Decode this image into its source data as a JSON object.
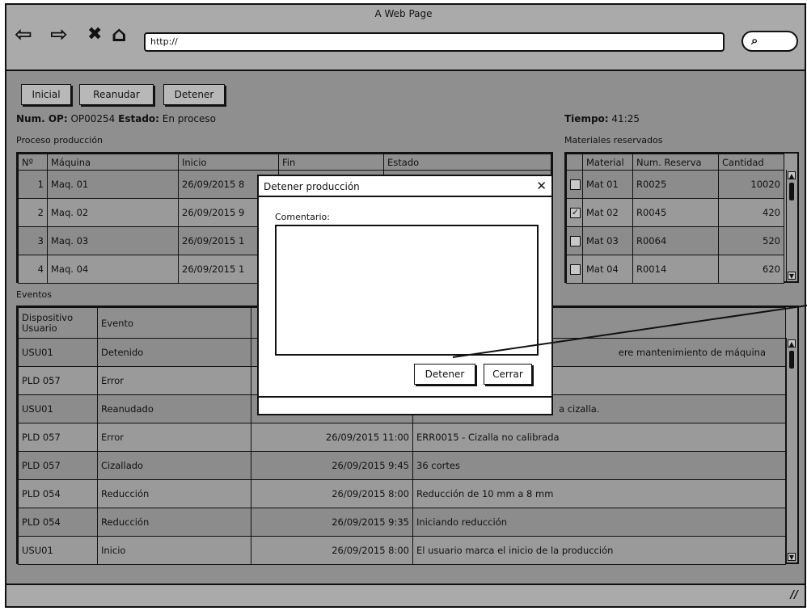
{
  "window": {
    "title": "A Web Page"
  },
  "browser": {
    "url": "http://",
    "nav": {
      "back": "⇦",
      "forward": "⇨",
      "stop": "✖",
      "home": "⌂"
    },
    "search_icon": "search-icon"
  },
  "toolbar": {
    "inicial": "Inicial",
    "reanudar": "Reanudar",
    "detener": "Detener"
  },
  "order": {
    "num_label": "Num. OP:",
    "num_value": "OP00254",
    "estado_label": "Estado:",
    "estado_value": "En proceso"
  },
  "tiempo": {
    "label": "Tiempo:",
    "value": "41:25"
  },
  "proceso": {
    "title": "Proceso producción",
    "headers": [
      "Nº",
      "Máquina",
      "Inicio",
      "Fin",
      "Estado"
    ],
    "rows": [
      {
        "n": "1",
        "maquina": "Maq. 01",
        "inicio": "26/09/2015 8"
      },
      {
        "n": "2",
        "maquina": "Maq. 02",
        "inicio": "26/09/2015 9"
      },
      {
        "n": "3",
        "maquina": "Maq. 03",
        "inicio": "26/09/2015 1"
      },
      {
        "n": "4",
        "maquina": "Maq. 04",
        "inicio": "26/09/2015 1"
      }
    ]
  },
  "materiales": {
    "title": "Materiales reservados",
    "headers": [
      "Material",
      "Num. Reserva",
      "Cantidad"
    ],
    "rows": [
      {
        "checked": "",
        "material": "Mat 01",
        "reserva": "R0025",
        "cantidad": "10020"
      },
      {
        "checked": "✓",
        "material": "Mat 02",
        "reserva": "R0045",
        "cantidad": "420"
      },
      {
        "checked": "",
        "material": "Mat 03",
        "reserva": "R0064",
        "cantidad": "520"
      },
      {
        "checked": "",
        "material": "Mat 04",
        "reserva": "R0014",
        "cantidad": "620"
      }
    ]
  },
  "eventos": {
    "title": "Eventos",
    "headers": [
      "Dispositivo Usuario",
      "Evento",
      "",
      ""
    ],
    "rows": [
      {
        "dispositivo": "USU01",
        "evento": "Detenido",
        "fecha": "",
        "detalle": "ere mantenimiento de máquina"
      },
      {
        "dispositivo": "PLD 057",
        "evento": "Error",
        "fecha": "",
        "detalle": ""
      },
      {
        "dispositivo": "USU01",
        "evento": "Reanudado",
        "fecha": "",
        "detalle": "a cizalla."
      },
      {
        "dispositivo": "PLD 057",
        "evento": "Error",
        "fecha": "26/09/2015 11:00",
        "detalle": "ERR0015 - Cizalla no calibrada"
      },
      {
        "dispositivo": "PLD 057",
        "evento": "Cizallado",
        "fecha": "26/09/2015 9:45",
        "detalle": "36 cortes"
      },
      {
        "dispositivo": "PLD 054",
        "evento": "Reducción",
        "fecha": "26/09/2015 8:00",
        "detalle": "Reducción de 10 mm a 8 mm"
      },
      {
        "dispositivo": "PLD 054",
        "evento": "Reducción",
        "fecha": "26/09/2015 9:35",
        "detalle": "Iniciando reducción"
      },
      {
        "dispositivo": "USU01",
        "evento": "Inicio",
        "fecha": "26/09/2015 8:00",
        "detalle": "El usuario marca el inicio de la producción"
      }
    ]
  },
  "dialog": {
    "title": "Detener producción",
    "close": "✕",
    "comment_label": "Comentario:",
    "comment_value": "",
    "detener": "Detener",
    "cerrar": "Cerrar"
  },
  "statusbar": {
    "resize_glyph": "//"
  }
}
